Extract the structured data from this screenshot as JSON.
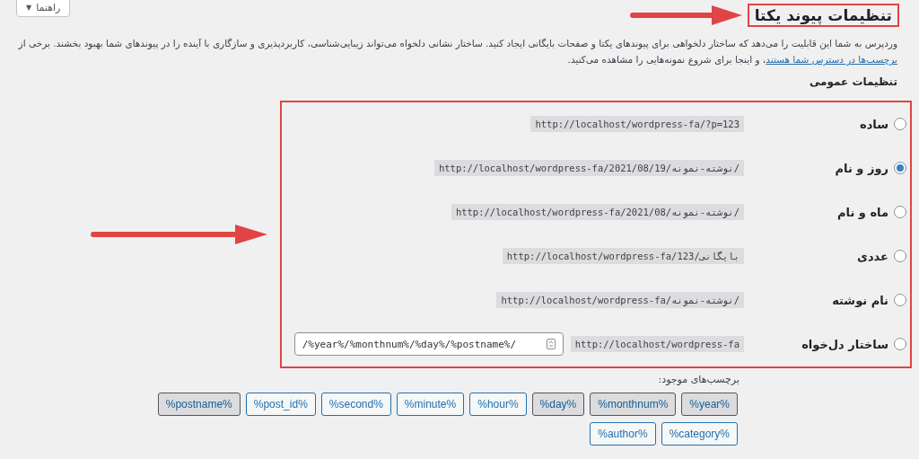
{
  "help_button": {
    "label": "راهنما",
    "caret": "▼"
  },
  "title": "تنظیمات پیوند یکتا",
  "intro": {
    "before": "وردپرس به شما این قابلیت را می‌دهد که ساختار دلخواهی برای پیوندهای یکتا و صفحات بایگانی ایجاد کنید. ساختار نشانی دلخواه می‌تواند زیبایی‌شناسی، کاربردپذیری و سازگاری با آینده را در پیوندهای شما بهبود بخشند. برخی از ",
    "link": "برچسب‌ها در دسترس شما هستند",
    "after": "، و اینجا برای شروع نمونه‌هایی را مشاهده می‌کنید."
  },
  "section_title": "تنظیمات عمومی",
  "options": [
    {
      "kind": "preset",
      "label": "ساده",
      "selected": false,
      "example": "http://localhost/wordpress-fa/?p=123"
    },
    {
      "kind": "preset",
      "label": "روز و نام",
      "selected": true,
      "example": "http://localhost/wordpress-fa/2021/08/19/نوشته-نمونه/"
    },
    {
      "kind": "preset",
      "label": "ماه و نام",
      "selected": false,
      "example": "http://localhost/wordpress-fa/2021/08/نوشته-نمونه/"
    },
    {
      "kind": "preset",
      "label": "عددی",
      "selected": false,
      "example": "http://localhost/wordpress-fa/بایگانی/123"
    },
    {
      "kind": "preset",
      "label": "نام نوشته",
      "selected": false,
      "example": "http://localhost/wordpress-fa/نوشته-نمونه/"
    },
    {
      "kind": "custom",
      "label": "ساختار دل‌خواه",
      "selected": false,
      "example": "http://localhost/wordpress-fa",
      "value": "/%year%/%monthnum%/%day%/%postname%/"
    }
  ],
  "tags_label": "برچسب‌های موجود:",
  "tags": [
    {
      "label": "%year%",
      "selected": true
    },
    {
      "label": "%monthnum%",
      "selected": true
    },
    {
      "label": "%day%",
      "selected": true
    },
    {
      "label": "%hour%",
      "selected": false
    },
    {
      "label": "%minute%",
      "selected": false
    },
    {
      "label": "%second%",
      "selected": false
    },
    {
      "label": "%post_id%",
      "selected": false
    },
    {
      "label": "%postname%",
      "selected": true
    },
    {
      "label": "%category%",
      "selected": false
    },
    {
      "label": "%author%",
      "selected": false
    }
  ]
}
